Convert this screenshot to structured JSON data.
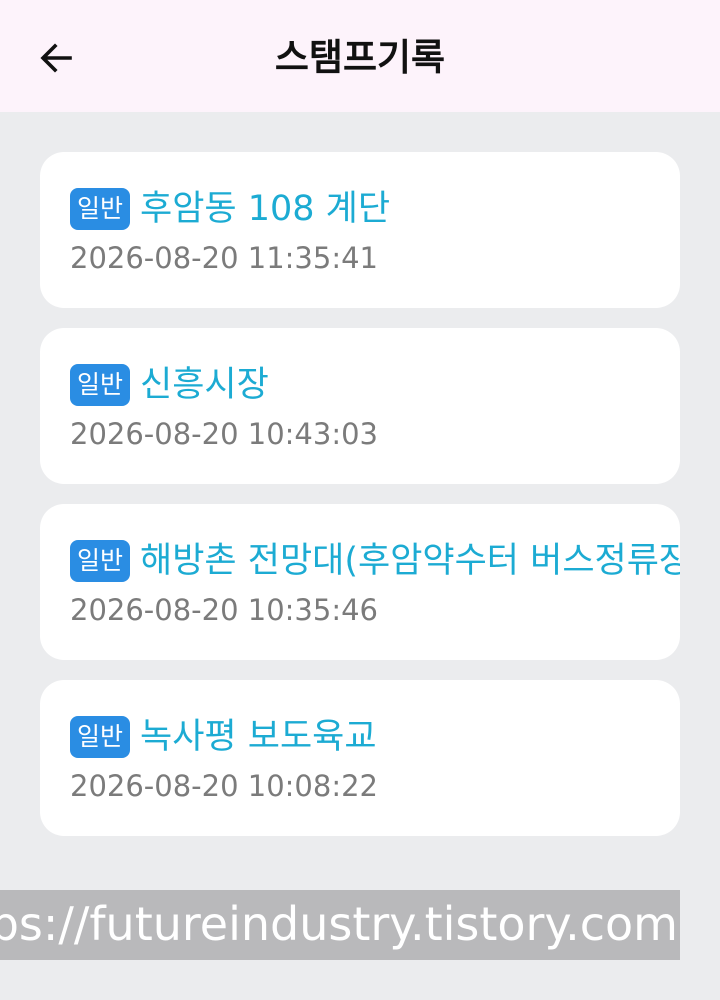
{
  "header": {
    "back_icon": "arrow-left-icon",
    "title": "스탬프기록"
  },
  "records": [
    {
      "badge": "일반",
      "place": "후암동 108 계단",
      "time": "2026-08-20 11:35:41"
    },
    {
      "badge": "일반",
      "place": "신흥시장",
      "time": "2026-08-20 10:43:03"
    },
    {
      "badge": "일반",
      "place": "해방촌 전망대(후암약수터 버스정류장",
      "time": "2026-08-20 10:35:46"
    },
    {
      "badge": "일반",
      "place": "녹사평 보도육교",
      "time": "2026-08-20 10:08:22"
    }
  ],
  "watermark": "https://futureindustry.tistory.com",
  "colors": {
    "header_bg": "#fdf3fb",
    "page_bg": "#ebecee",
    "badge_bg": "#2a8de3",
    "place_text": "#1cabd3",
    "time_text": "#7b7b7b"
  }
}
